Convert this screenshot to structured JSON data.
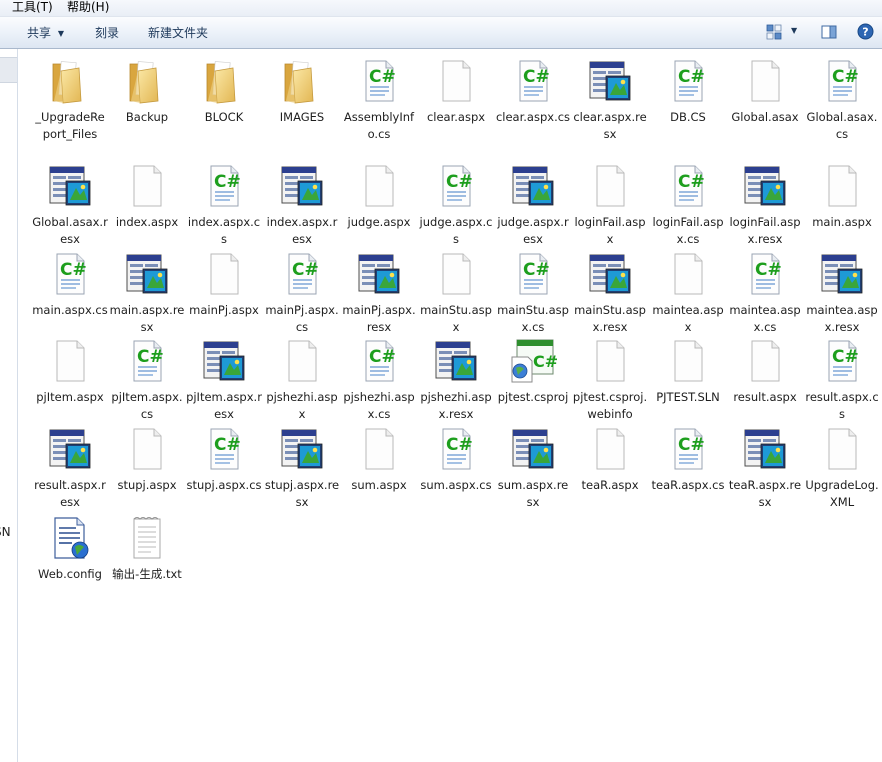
{
  "menubar": {
    "tools": "工具(T)",
    "help": "帮助(H)"
  },
  "toolbar": {
    "share": "共享",
    "burn": "刻录",
    "new_folder": "新建文件夹"
  },
  "nav": {
    "partial_text": "SN"
  },
  "files": [
    {
      "name": "_UpgradeReport_Files",
      "type": "folder"
    },
    {
      "name": "Backup",
      "type": "folder"
    },
    {
      "name": "BLOCK",
      "type": "folder"
    },
    {
      "name": "IMAGES",
      "type": "folder"
    },
    {
      "name": "AssemblyInfo.cs",
      "type": "cs"
    },
    {
      "name": "clear.aspx",
      "type": "blank"
    },
    {
      "name": "clear.aspx.cs",
      "type": "cs"
    },
    {
      "name": "clear.aspx.resx",
      "type": "resx"
    },
    {
      "name": "DB.CS",
      "type": "cs"
    },
    {
      "name": "Global.asax",
      "type": "blank"
    },
    {
      "name": "Global.asax.cs",
      "type": "cs"
    },
    {
      "name": "Global.asax.resx",
      "type": "resx"
    },
    {
      "name": "index.aspx",
      "type": "blank"
    },
    {
      "name": "index.aspx.cs",
      "type": "cs"
    },
    {
      "name": "index.aspx.resx",
      "type": "resx"
    },
    {
      "name": "judge.aspx",
      "type": "blank"
    },
    {
      "name": "judge.aspx.cs",
      "type": "cs"
    },
    {
      "name": "judge.aspx.resx",
      "type": "resx"
    },
    {
      "name": "loginFail.aspx",
      "type": "blank"
    },
    {
      "name": "loginFail.aspx.cs",
      "type": "cs"
    },
    {
      "name": "loginFail.aspx.resx",
      "type": "resx"
    },
    {
      "name": "main.aspx",
      "type": "blank"
    },
    {
      "name": "main.aspx.cs",
      "type": "cs"
    },
    {
      "name": "main.aspx.resx",
      "type": "resx"
    },
    {
      "name": "mainPj.aspx",
      "type": "blank"
    },
    {
      "name": "mainPj.aspx.cs",
      "type": "cs"
    },
    {
      "name": "mainPj.aspx.resx",
      "type": "resx"
    },
    {
      "name": "mainStu.aspx",
      "type": "blank"
    },
    {
      "name": "mainStu.aspx.cs",
      "type": "cs"
    },
    {
      "name": "mainStu.aspx.resx",
      "type": "resx"
    },
    {
      "name": "maintea.aspx",
      "type": "blank"
    },
    {
      "name": "maintea.aspx.cs",
      "type": "cs"
    },
    {
      "name": "maintea.aspx.resx",
      "type": "resx"
    },
    {
      "name": "pjItem.aspx",
      "type": "blank"
    },
    {
      "name": "pjItem.aspx.cs",
      "type": "cs"
    },
    {
      "name": "pjItem.aspx.resx",
      "type": "resx"
    },
    {
      "name": "pjshezhi.aspx",
      "type": "blank"
    },
    {
      "name": "pjshezhi.aspx.cs",
      "type": "cs"
    },
    {
      "name": "pjshezhi.aspx.resx",
      "type": "resx"
    },
    {
      "name": "pjtest.csproj",
      "type": "csproj"
    },
    {
      "name": "pjtest.csproj.webinfo",
      "type": "blank"
    },
    {
      "name": "PJTEST.SLN",
      "type": "blank"
    },
    {
      "name": "result.aspx",
      "type": "blank"
    },
    {
      "name": "result.aspx.cs",
      "type": "cs"
    },
    {
      "name": "result.aspx.resx",
      "type": "resx"
    },
    {
      "name": "stupj.aspx",
      "type": "blank"
    },
    {
      "name": "stupj.aspx.cs",
      "type": "cs"
    },
    {
      "name": "stupj.aspx.resx",
      "type": "resx"
    },
    {
      "name": "sum.aspx",
      "type": "blank"
    },
    {
      "name": "sum.aspx.cs",
      "type": "cs"
    },
    {
      "name": "sum.aspx.resx",
      "type": "resx"
    },
    {
      "name": "teaR.aspx",
      "type": "blank"
    },
    {
      "name": "teaR.aspx.cs",
      "type": "cs"
    },
    {
      "name": "teaR.aspx.resx",
      "type": "resx"
    },
    {
      "name": "UpgradeLog.XML",
      "type": "blank"
    },
    {
      "name": "Web.config",
      "type": "config"
    },
    {
      "name": "输出-生成.txt",
      "type": "txt"
    }
  ]
}
